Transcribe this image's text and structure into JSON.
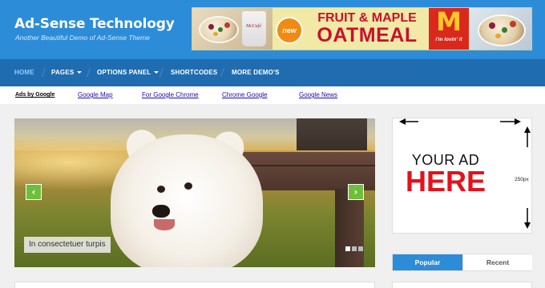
{
  "site": {
    "title": "Ad-Sense Technology",
    "tagline": "Another Beautiful Demo of Ad-Sense Theme"
  },
  "banner_ad": {
    "badge": "new",
    "line1": "FRUIT & MAPLE",
    "line2": "OATMEAL",
    "brand_logo": "M",
    "brand_slogan": "i'm lovin' it",
    "cup_logo": "McCafé",
    "colors": {
      "background": "#f3e9a6",
      "headline": "#c8102e",
      "brand_bg": "#da291c",
      "brand_logo": "#ffc72c",
      "badge": "#f08a12"
    }
  },
  "nav": {
    "items": [
      {
        "label": "HOME",
        "active": true,
        "has_dropdown": false
      },
      {
        "label": "PAGES",
        "active": false,
        "has_dropdown": true
      },
      {
        "label": "OPTIONS PANEL",
        "active": false,
        "has_dropdown": true
      },
      {
        "label": "SHORTCODES",
        "active": false,
        "has_dropdown": false
      },
      {
        "label": "MORE DEMO'S",
        "active": false,
        "has_dropdown": false
      }
    ],
    "colors": {
      "background": "#1f6db0",
      "active_text": "#8ecbff",
      "text": "#ffffff"
    }
  },
  "link_bar": {
    "ads_label": "Ads by Google",
    "links": [
      "Google Map",
      "For Google Chrome",
      "Chrome Google",
      "Google News"
    ]
  },
  "slider": {
    "caption": "In consectetuer turpis",
    "prev_icon": "chevron-left-icon",
    "next_icon": "chevron-right-icon",
    "prev_glyph": "‹",
    "next_glyph": "›",
    "dots_total": 3,
    "active_dot": 1,
    "colors": {
      "arrow": "#6fbd3c"
    }
  },
  "sidebar_ad": {
    "line1": "YOUR AD",
    "line2": "HERE",
    "height_label": "250px",
    "colors": {
      "line1": "#111111",
      "line2": "#e3121b"
    }
  },
  "tabs": {
    "items": [
      {
        "label": "Popular",
        "active": true
      },
      {
        "label": "Recent",
        "active": false
      }
    ],
    "colors": {
      "active": "#2d8cd8"
    }
  },
  "theme": {
    "header_bg": "#2d8cd8",
    "link_color": "#1a0dab"
  }
}
